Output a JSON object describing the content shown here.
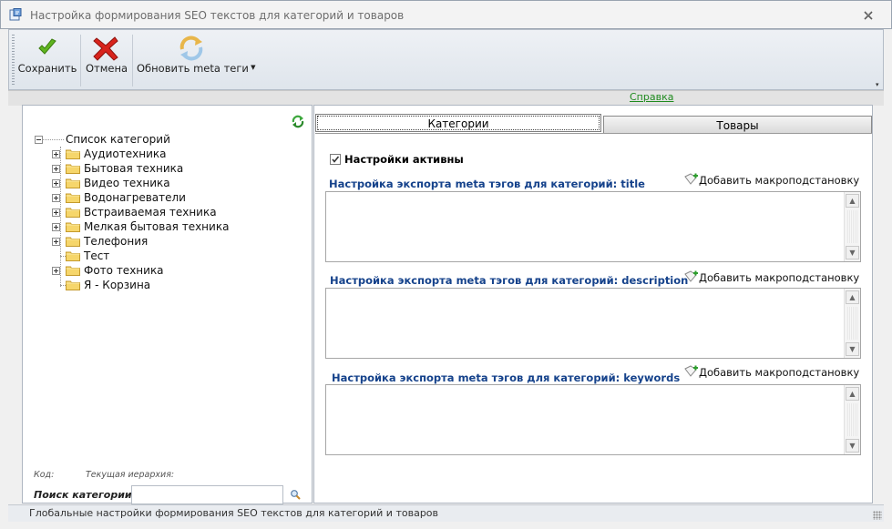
{
  "window": {
    "title": "Настройка формирования SEO текстов для категорий и товаров"
  },
  "toolbar": {
    "save_label": "Сохранить",
    "cancel_label": "Отмена",
    "refresh_meta_label": "Обновить meta теги"
  },
  "help_link": "Справка",
  "tree": {
    "root_label": "Список категорий",
    "items": [
      {
        "label": "Аудиотехника",
        "expandable": true
      },
      {
        "label": "Бытовая техника",
        "expandable": true
      },
      {
        "label": "Видео техника",
        "expandable": true
      },
      {
        "label": "Водонагреватели",
        "expandable": true
      },
      {
        "label": "Встраиваемая техника",
        "expandable": true
      },
      {
        "label": "Мелкая бытовая техника",
        "expandable": true
      },
      {
        "label": "Телефония",
        "expandable": true
      },
      {
        "label": "Тест",
        "expandable": false
      },
      {
        "label": "Фото техника",
        "expandable": true
      },
      {
        "label": "Я - Корзина",
        "expandable": false
      }
    ]
  },
  "left_footer": {
    "code_label": "Код:",
    "hierarchy_label": "Текущая иерархия:",
    "search_label": "Поиск категории:",
    "search_value": ""
  },
  "tabs": [
    {
      "label": "Категории",
      "active": true
    },
    {
      "label": "Товары",
      "active": false
    }
  ],
  "settings": {
    "active_checkbox_label": "Настройки активны",
    "active_checked": true,
    "add_macro_label": "Добавить макроподстановку",
    "sections": [
      {
        "title": "Настройка экспорта meta тэгов для категорий: title",
        "value": ""
      },
      {
        "title": "Настройка экспорта meta тэгов для категорий: description",
        "value": ""
      },
      {
        "title": "Настройка экспорта meta тэгов для категорий: keywords",
        "value": ""
      }
    ]
  },
  "status_bar": {
    "text": "Глобальные настройки формирования SEO текстов для категорий и товаров"
  },
  "colors": {
    "section_title": "#15428b",
    "help_link": "#1f8a1f",
    "tab_active_border": "#7f7f7f"
  }
}
